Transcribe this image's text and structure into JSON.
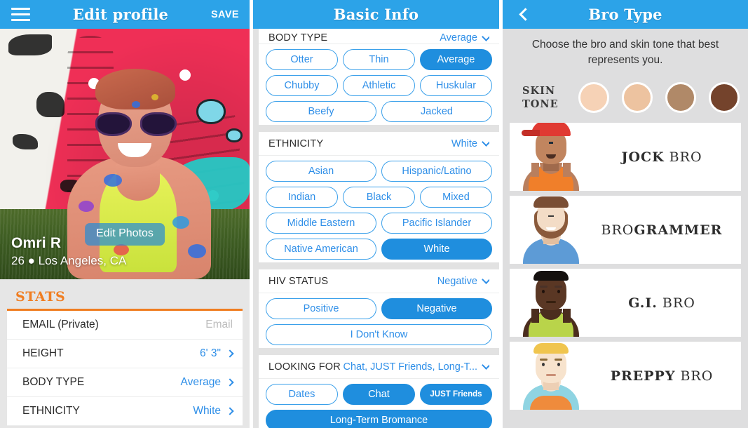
{
  "left": {
    "navbar": {
      "menu_icon": "hamburger-menu-icon",
      "title": "Edit profile",
      "save_label": "SAVE"
    },
    "photo": {
      "edit_photos_label": "Edit Photos",
      "name": "Omri R",
      "subtitle": "26 ● Los Angeles, CA"
    },
    "stats": {
      "section_title": "STATS",
      "rows": [
        {
          "label": "EMAIL (Private)",
          "value": "Email",
          "placeholder": true,
          "chevron": false
        },
        {
          "label": "HEIGHT",
          "value": "6' 3\"",
          "placeholder": false,
          "chevron": true
        },
        {
          "label": "BODY TYPE",
          "value": "Average",
          "placeholder": false,
          "chevron": true
        },
        {
          "label": "ETHNICITY",
          "value": "White",
          "placeholder": false,
          "chevron": true
        }
      ]
    }
  },
  "middle": {
    "navbar": {
      "title": "Basic Info"
    },
    "sections": [
      {
        "label": "BODY TYPE",
        "value": "Average",
        "clipped": true,
        "options": [
          {
            "label": "Otter",
            "selected": false,
            "width": "w3"
          },
          {
            "label": "Thin",
            "selected": false,
            "width": "w3"
          },
          {
            "label": "Average",
            "selected": true,
            "width": "w3"
          },
          {
            "label": "Chubby",
            "selected": false,
            "width": "w3"
          },
          {
            "label": "Athletic",
            "selected": false,
            "width": "w3"
          },
          {
            "label": "Huskular",
            "selected": false,
            "width": "w3"
          },
          {
            "label": "Beefy",
            "selected": false,
            "width": "w2"
          },
          {
            "label": "Jacked",
            "selected": false,
            "width": "w2"
          }
        ]
      },
      {
        "label": "ETHNICITY",
        "value": "White",
        "clipped": false,
        "options": [
          {
            "label": "Asian",
            "selected": false,
            "width": "w2"
          },
          {
            "label": "Hispanic/Latino",
            "selected": false,
            "width": "w2"
          },
          {
            "label": "Indian",
            "selected": false,
            "width": "w3"
          },
          {
            "label": "Black",
            "selected": false,
            "width": "w3"
          },
          {
            "label": "Mixed",
            "selected": false,
            "width": "w3"
          },
          {
            "label": "Middle Eastern",
            "selected": false,
            "width": "w2"
          },
          {
            "label": "Pacific Islander",
            "selected": false,
            "width": "w2"
          },
          {
            "label": "Native American",
            "selected": false,
            "width": "w2"
          },
          {
            "label": "White",
            "selected": true,
            "width": "w2"
          }
        ]
      },
      {
        "label": "HIV STATUS",
        "value": "Negative",
        "clipped": false,
        "options": [
          {
            "label": "Positive",
            "selected": false,
            "width": "w2"
          },
          {
            "label": "Negative",
            "selected": true,
            "width": "w2"
          },
          {
            "label": "I Don't Know",
            "selected": false,
            "width": "w1"
          }
        ]
      },
      {
        "label": "LOOKING FOR",
        "value": "Chat, JUST Friends, Long-T...",
        "clipped": false,
        "options": [
          {
            "label": "Dates",
            "selected": false,
            "width": "w3"
          },
          {
            "label": "Chat",
            "selected": true,
            "width": "w3"
          },
          {
            "label": "JUST Friends",
            "selected": true,
            "width": "w3",
            "small": true
          },
          {
            "label": "Long-Term Bromance",
            "selected": true,
            "width": "w1"
          }
        ]
      }
    ]
  },
  "right": {
    "navbar": {
      "back_icon": "chevron-left-icon",
      "title": "Bro Type"
    },
    "intro": "Choose the bro and skin tone that best represents you.",
    "skin_tone": {
      "label_line1": "SKIN",
      "label_line2": "TONE",
      "swatches": [
        "#f6d2b6",
        "#edc3a0",
        "#b08968",
        "#74432c"
      ]
    },
    "bro_types": [
      {
        "name_bold": "JOCK",
        "name_rest": " BRO",
        "avatar": "jock-bro-avatar"
      },
      {
        "name_bold": "BRO",
        "name_rest": "GRAMMER",
        "avatar": "brogrammer-avatar",
        "bold_last": true
      },
      {
        "name_bold": "G.I.",
        "name_rest": " BRO",
        "avatar": "gi-bro-avatar"
      },
      {
        "name_bold": "PREPPY",
        "name_rest": " BRO",
        "avatar": "preppy-bro-avatar"
      }
    ]
  },
  "colors": {
    "brand_blue": "#2ca3e8",
    "accent_orange": "#f07d21",
    "link_blue": "#2f8fe8",
    "pill_selected": "#1f8ede"
  }
}
